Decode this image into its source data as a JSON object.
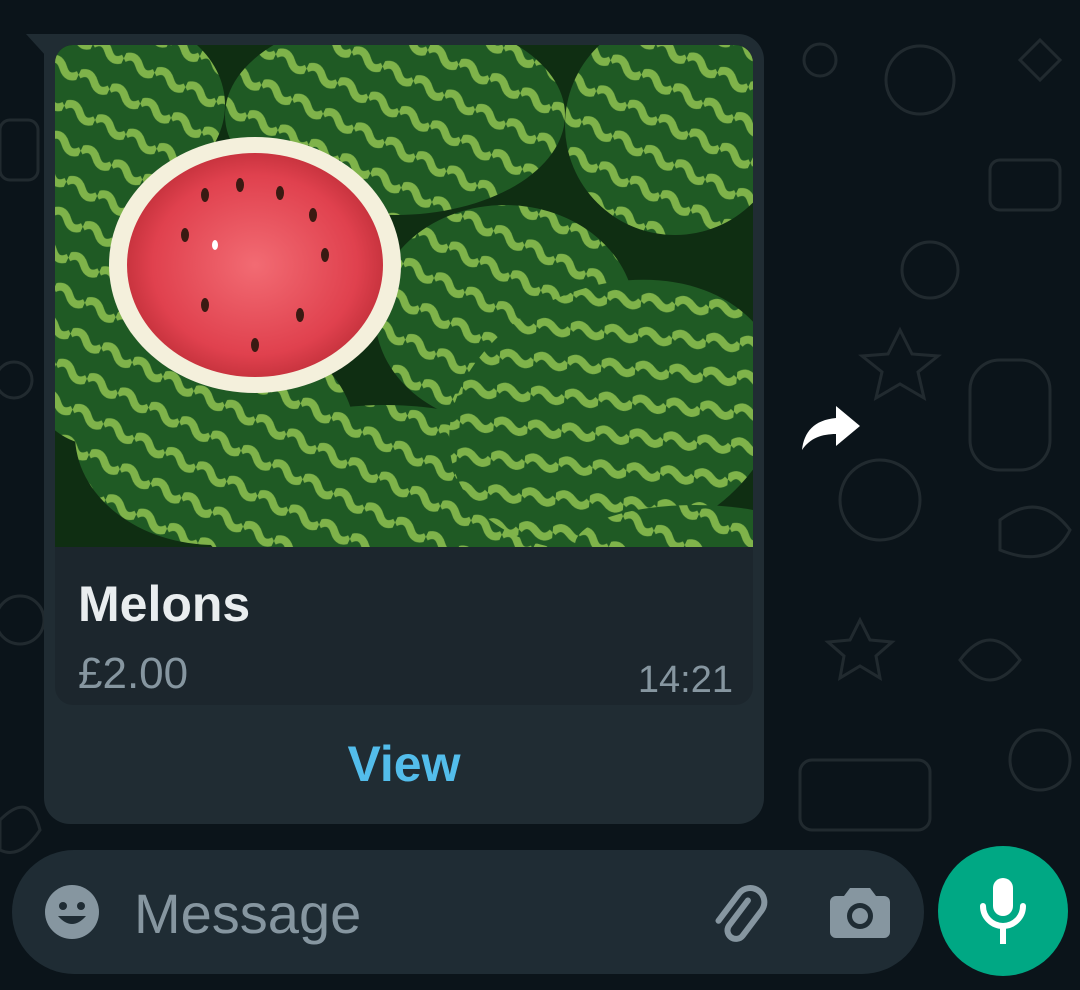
{
  "message": {
    "product": {
      "image_icon": "watermelon-photo",
      "title": "Melons",
      "price": "£2.00"
    },
    "time": "14:21",
    "view_label": "View",
    "forward_icon": "forward-icon"
  },
  "input_bar": {
    "placeholder": "Message",
    "emoji_icon": "smiley-icon",
    "attach_icon": "paperclip-icon",
    "camera_icon": "camera-icon"
  },
  "mic_button": {
    "icon": "microphone-icon",
    "color": "#00a884"
  },
  "colors": {
    "background": "#0b141a",
    "bubble": "#202c33",
    "link": "#53bdeb",
    "text_primary": "#e9edef",
    "text_secondary": "#8696a0"
  }
}
